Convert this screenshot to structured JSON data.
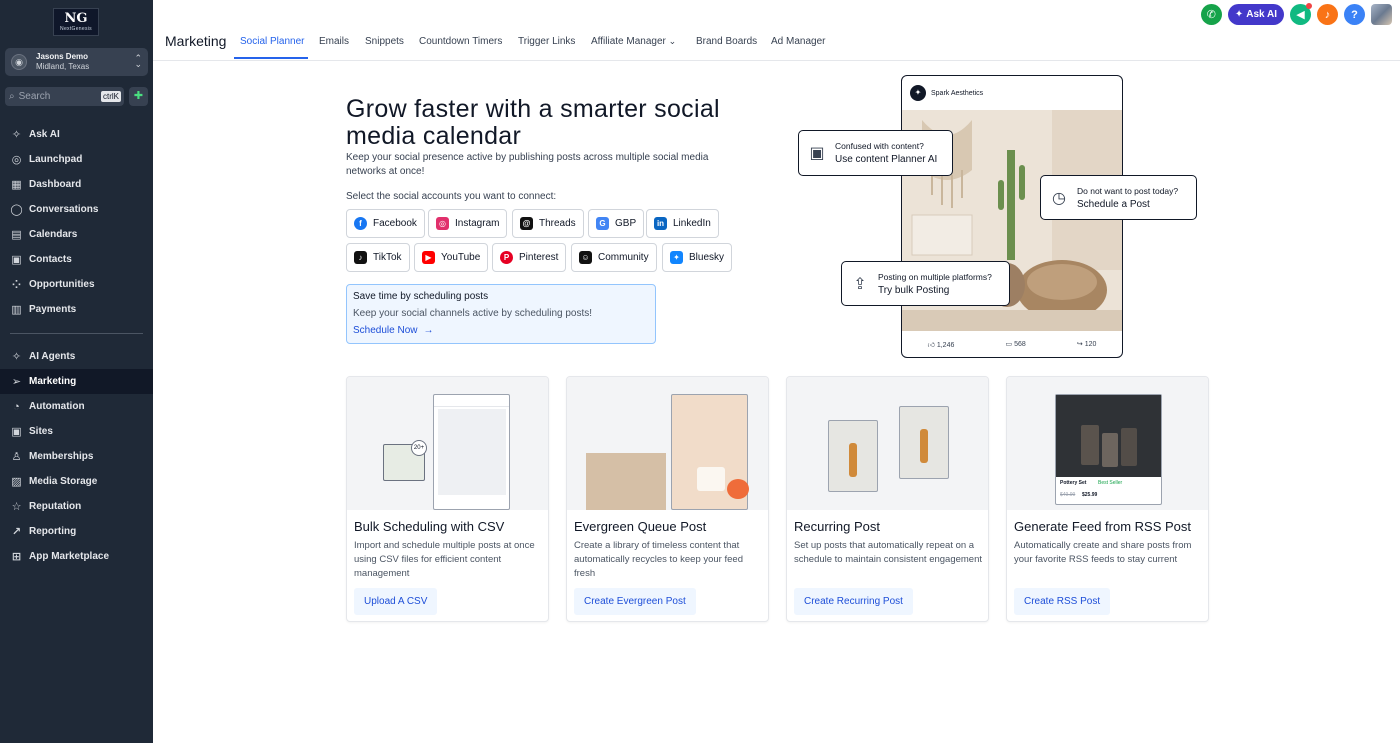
{
  "sidebar": {
    "logo_mark": "NG",
    "logo_text": "NextGenesis",
    "account": {
      "name": "Jasons Demo",
      "location": "Midland, Texas"
    },
    "search": {
      "placeholder": "Search",
      "shortcut": "ctrlK"
    },
    "items": [
      {
        "label": "Ask AI",
        "icon": "sparkles-icon"
      },
      {
        "label": "Launchpad",
        "icon": "rocket-icon"
      },
      {
        "label": "Dashboard",
        "icon": "dashboard-icon"
      },
      {
        "label": "Conversations",
        "icon": "chat-icon"
      },
      {
        "label": "Calendars",
        "icon": "calendar-icon"
      },
      {
        "label": "Contacts",
        "icon": "contacts-icon"
      },
      {
        "label": "Opportunities",
        "icon": "opportunities-icon"
      },
      {
        "label": "Payments",
        "icon": "payments-icon"
      }
    ],
    "items2": [
      {
        "label": "AI Agents",
        "icon": "ai-agents-icon"
      },
      {
        "label": "Marketing",
        "icon": "send-icon",
        "active": true
      },
      {
        "label": "Automation",
        "icon": "automation-icon"
      },
      {
        "label": "Sites",
        "icon": "sites-icon"
      },
      {
        "label": "Memberships",
        "icon": "memberships-icon"
      },
      {
        "label": "Media Storage",
        "icon": "media-icon"
      },
      {
        "label": "Reputation",
        "icon": "reputation-icon"
      },
      {
        "label": "Reporting",
        "icon": "reporting-icon"
      },
      {
        "label": "App Marketplace",
        "icon": "marketplace-icon"
      }
    ]
  },
  "header": {
    "section_title": "Marketing",
    "tabs": [
      "Social Planner",
      "Emails",
      "Snippets",
      "Countdown Timers",
      "Trigger Links",
      "Affiliate Manager",
      "Brand Boards",
      "Ad Manager"
    ],
    "active_tab": "Social Planner",
    "ask_ai_label": "Ask AI"
  },
  "hero": {
    "title": "Grow faster with a smarter social media calendar",
    "subtitle": "Keep your social presence active by publishing posts across multiple social media networks at once!",
    "select_label": "Select the social accounts you want to connect:"
  },
  "accounts": [
    {
      "label": "Facebook",
      "color": "#1877f2",
      "glyph": "f"
    },
    {
      "label": "Instagram",
      "color": "#e1306c",
      "glyph": "◎"
    },
    {
      "label": "Threads",
      "color": "#111111",
      "glyph": "@"
    },
    {
      "label": "GBP",
      "color": "#4285f4",
      "glyph": "G"
    },
    {
      "label": "LinkedIn",
      "color": "#0a66c2",
      "glyph": "in"
    },
    {
      "label": "TikTok",
      "color": "#111111",
      "glyph": "♪"
    },
    {
      "label": "YouTube",
      "color": "#ff0000",
      "glyph": "▶"
    },
    {
      "label": "Pinterest",
      "color": "#e60023",
      "glyph": "P"
    },
    {
      "label": "Community",
      "color": "#111111",
      "glyph": "☺"
    },
    {
      "label": "Bluesky",
      "color": "#1185fe",
      "glyph": "✦"
    }
  ],
  "promo": {
    "title": "Save time by scheduling posts",
    "text": "Keep your social channels active by scheduling posts!",
    "link": "Schedule Now"
  },
  "preview": {
    "brand": "Spark Aesthetics",
    "likes": "1,246",
    "comments": "568",
    "shares": "120",
    "callout1": {
      "line1": "Confused with content?",
      "line2": "Use content Planner AI"
    },
    "callout2": {
      "line1": "Do not want to post today?",
      "line2": "Schedule a Post"
    },
    "callout3": {
      "line1": "Posting on multiple platforms?",
      "line2": "Try bulk Posting"
    }
  },
  "cards": [
    {
      "title": "Bulk Scheduling with CSV",
      "desc": "Import and schedule multiple posts at once using CSV files for efficient content management",
      "button": "Upload A CSV",
      "badge": "20+"
    },
    {
      "title": "Evergreen Queue Post",
      "desc": "Create a library of timeless content that automatically recycles to keep your feed fresh",
      "button": "Create Evergreen Post"
    },
    {
      "title": "Recurring Post",
      "desc": "Set up posts that automatically repeat on a schedule to maintain consistent engagement",
      "button": "Create Recurring Post"
    },
    {
      "title": "Generate Feed from RSS Post",
      "desc": "Automatically create and share posts from your favorite RSS feeds to stay current",
      "button": "Create RSS Post",
      "product": {
        "name": "Pottery Set",
        "badge": "Best Seller",
        "old_price": "$49.99",
        "price": "$25.99"
      }
    }
  ]
}
